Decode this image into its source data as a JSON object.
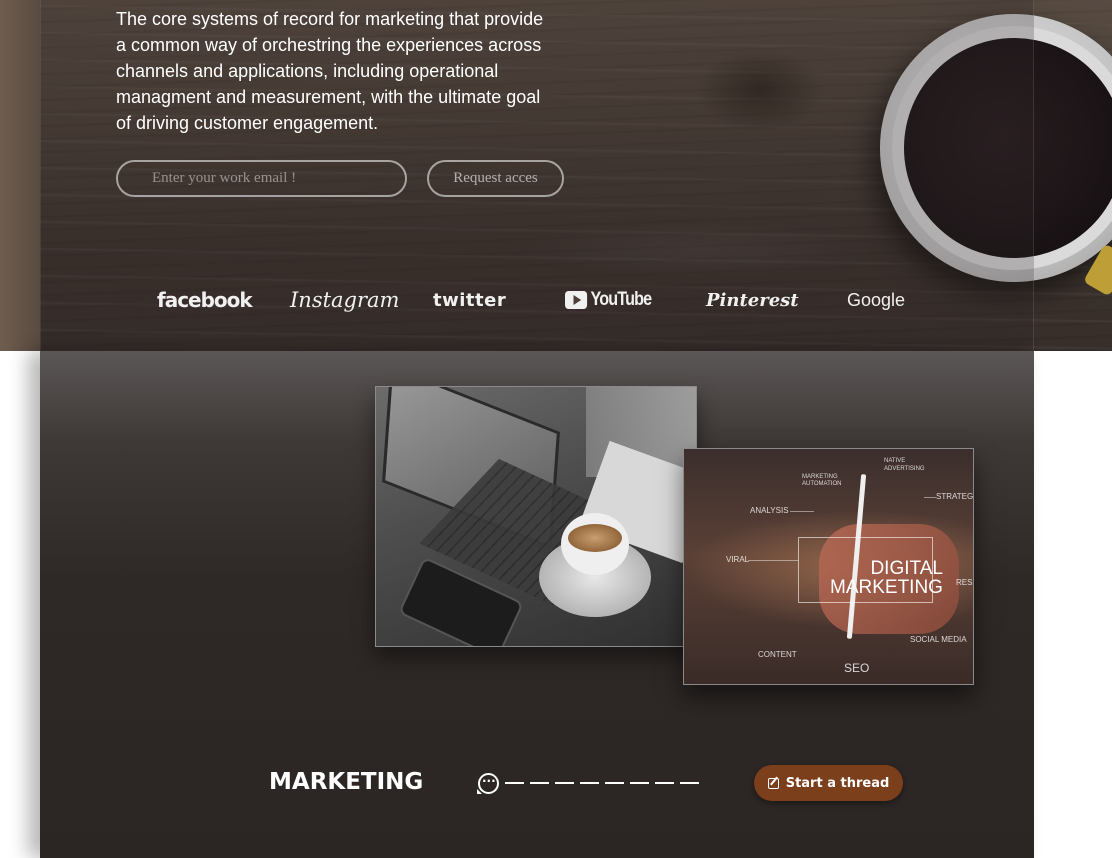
{
  "hero": {
    "description": "The core systems of record for marketing that provide a common way of orchestring the experiences across channels and applications, including operational managment and measurement, with the ultimate goal of driving customer engagement.",
    "email_placeholder": "Enter your work email !",
    "request_button": "Request acces"
  },
  "brands": [
    "facebook",
    "Instagram",
    "twitter",
    "YouTube",
    "Pinterest",
    "Google"
  ],
  "digital_image": {
    "headline_1": "DIGITAL",
    "headline_2": "MARKETING",
    "labels": [
      "NATIVE ADVERTISING",
      "MARKETING AUTOMATION",
      "ANALYSIS",
      "STRATEGY",
      "VIRAL",
      "RESE",
      "SOCIAL MEDIA",
      "CONTENT",
      "SEO"
    ]
  },
  "section": {
    "title": "MARKETING",
    "start_thread": "Start a thread"
  },
  "colors": {
    "accent": "#7c3f1c",
    "panel": "#2b2624"
  },
  "icons": {
    "thread": "chat-bubble-icon",
    "edit": "edit-icon"
  }
}
